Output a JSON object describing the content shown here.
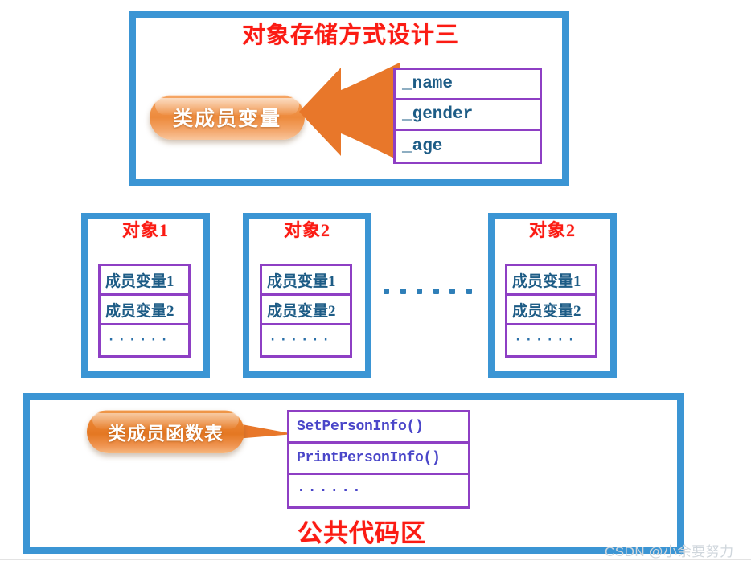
{
  "diagram": {
    "top_panel": {
      "title": "对象存储方式设计三",
      "callout_label": "类成员变量",
      "member_table": [
        "_name",
        "_gender",
        "_age"
      ]
    },
    "object_boxes": [
      {
        "title": "对象1",
        "rows": [
          "成员变量1",
          "成员变量2",
          "······"
        ]
      },
      {
        "title": "对象2",
        "rows": [
          "成员变量1",
          "成员变量2",
          "······"
        ]
      },
      {
        "title": "对象2",
        "rows": [
          "成员变量1",
          "成员变量2",
          "······"
        ]
      }
    ],
    "ellipsis_between_boxes": "······",
    "bottom_panel": {
      "callout_label": "类成员函数表",
      "title": "公共代码区",
      "function_table": [
        "SetPersonInfo()",
        "PrintPersonInfo()",
        "······"
      ]
    },
    "watermark": "CSDN @小余要努力",
    "colors": {
      "frame_blue": "#3b95d4",
      "title_red": "#fb1b13",
      "table_purple": "#8e3fc4",
      "member_text_blue": "#1d5c86",
      "function_text_violet": "#4a46c9",
      "callout_orange": "#e47722",
      "callout_orange_light": "#f6a868",
      "dots_blue": "#2f7fb8",
      "watermark_gray": "#cfd6dc"
    }
  }
}
